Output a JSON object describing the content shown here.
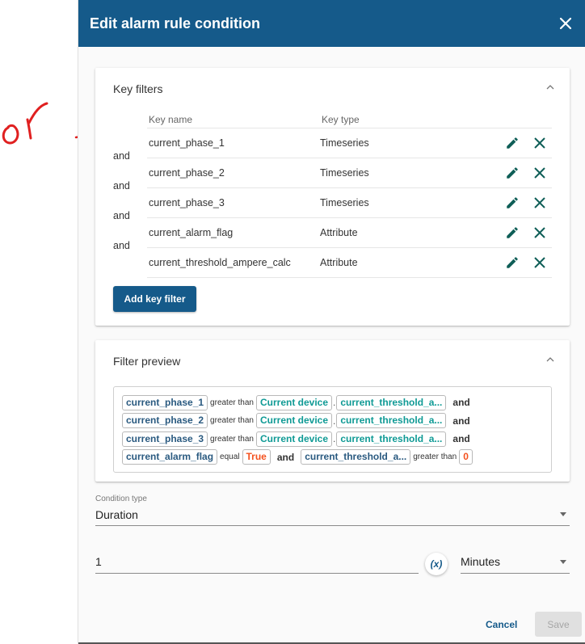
{
  "dialog": {
    "title": "Edit alarm rule condition"
  },
  "key_filters": {
    "title": "Key filters",
    "col_key_name": "Key name",
    "col_key_type": "Key type",
    "rows": [
      {
        "key": "current_phase_1",
        "type": "Timeseries"
      },
      {
        "key": "current_phase_2",
        "type": "Timeseries"
      },
      {
        "key": "current_phase_3",
        "type": "Timeseries"
      },
      {
        "key": "current_alarm_flag",
        "type": "Attribute"
      },
      {
        "key": "current_threshold_ampere_calc",
        "type": "Attribute"
      }
    ],
    "joins": [
      "and",
      "and",
      "and",
      "and"
    ],
    "add_button": "Add key filter"
  },
  "filter_preview": {
    "title": "Filter preview",
    "lines": [
      {
        "key": "current_phase_1",
        "op": "greater than",
        "source": "Current device",
        "dot": ".",
        "ref": "current_threshold_a...",
        "conj": "and"
      },
      {
        "key": "current_phase_2",
        "op": "greater than",
        "source": "Current device",
        "dot": ".",
        "ref": "current_threshold_a...",
        "conj": "and"
      },
      {
        "key": "current_phase_3",
        "op": "greater than",
        "source": "Current device",
        "dot": ".",
        "ref": "current_threshold_a...",
        "conj": "and"
      }
    ],
    "last_line": {
      "key": "current_alarm_flag",
      "op": "equal",
      "value": "True",
      "conj": "and",
      "key2": "current_threshold_a...",
      "op2": "greater than",
      "value2": "0"
    }
  },
  "condition_type": {
    "label": "Condition type",
    "value": "Duration"
  },
  "duration": {
    "value": "1",
    "var_button": "(x)",
    "unit": "Minutes"
  },
  "actions": {
    "cancel": "Cancel",
    "save": "Save"
  },
  "annotation": {
    "text": "or",
    "color": "#e02020"
  },
  "colors": {
    "header": "#155a8a",
    "icon_action": "#0f5e57",
    "chip_source": "#0f9a95",
    "chip_value": "#f4511e"
  }
}
